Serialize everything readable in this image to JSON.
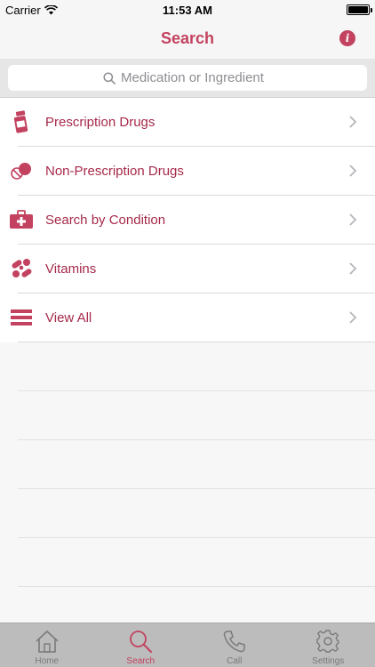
{
  "status_bar": {
    "carrier": "Carrier",
    "time": "11:53 AM"
  },
  "nav": {
    "title": "Search"
  },
  "search": {
    "placeholder": "Medication or Ingredient",
    "value": ""
  },
  "list": {
    "items": [
      {
        "label": "Prescription Drugs",
        "icon": "prescription-bottle-icon"
      },
      {
        "label": "Non-Prescription Drugs",
        "icon": "pills-icon"
      },
      {
        "label": "Search by Condition",
        "icon": "first-aid-kit-icon"
      },
      {
        "label": "Vitamins",
        "icon": "vitamins-icon"
      },
      {
        "label": "View All",
        "icon": "list-icon"
      }
    ]
  },
  "tabs": [
    {
      "label": "Home",
      "icon": "home-icon",
      "active": false
    },
    {
      "label": "Search",
      "icon": "search-icon",
      "active": true
    },
    {
      "label": "Call",
      "icon": "phone-icon",
      "active": false
    },
    {
      "label": "Settings",
      "icon": "gear-icon",
      "active": false
    }
  ],
  "colors": {
    "accent": "#c2425f",
    "label": "#a62a4b",
    "tab_inactive": "#7a7a7a",
    "tab_bar": "#bcbcbc"
  }
}
